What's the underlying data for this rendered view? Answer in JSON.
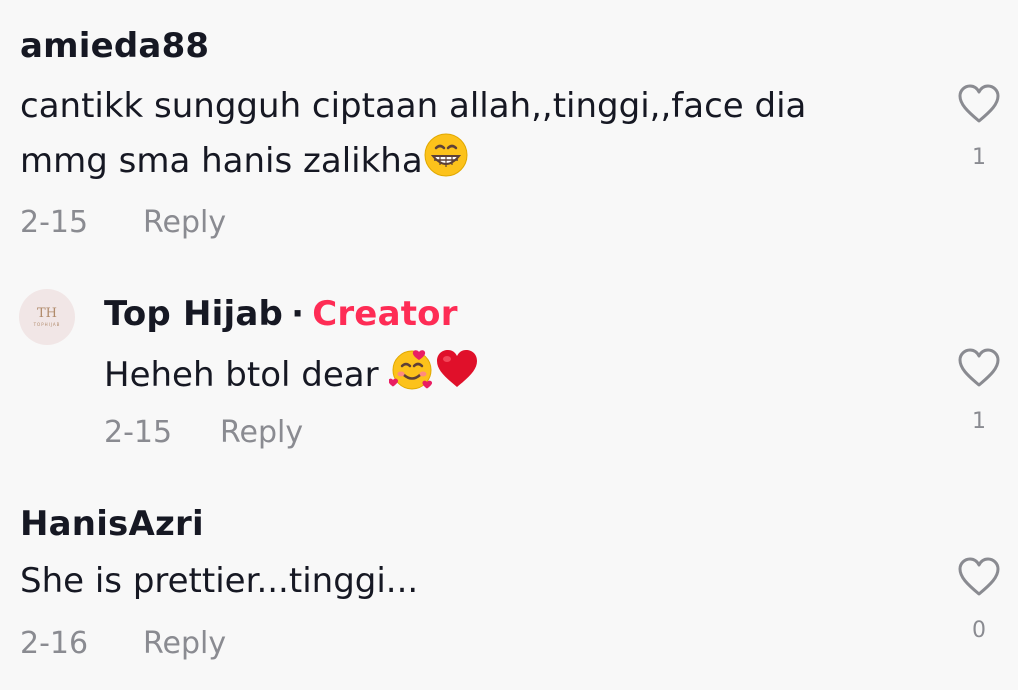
{
  "comments": [
    {
      "username": "amieda88",
      "text_line1": "cantikk sungguh ciptaan allah,,tinggi,,face dia",
      "text_line2": "mmg sma hanis zalikha",
      "date": "2-15",
      "reply_label": "Reply",
      "likes": "1"
    },
    {
      "username": "Top Hijab",
      "badge": "Creator",
      "separator": "·",
      "avatar_mono": "TH",
      "avatar_text": "TOPHIJAB",
      "text": "Heheh btol dear",
      "date": "2-15",
      "reply_label": "Reply",
      "likes": "1"
    },
    {
      "username": "HanisAzri",
      "text": "She is prettier...tinggi...",
      "date": "2-16",
      "reply_label": "Reply",
      "likes": "0"
    }
  ],
  "colors": {
    "background": "#f8f8f8",
    "text": "#161823",
    "muted": "#8a8b91",
    "creator": "#fe2c55"
  },
  "icons": [
    "heart-outline-icon",
    "grinning-face-emoji",
    "smiling-face-with-hearts-emoji",
    "red-heart-emoji"
  ]
}
